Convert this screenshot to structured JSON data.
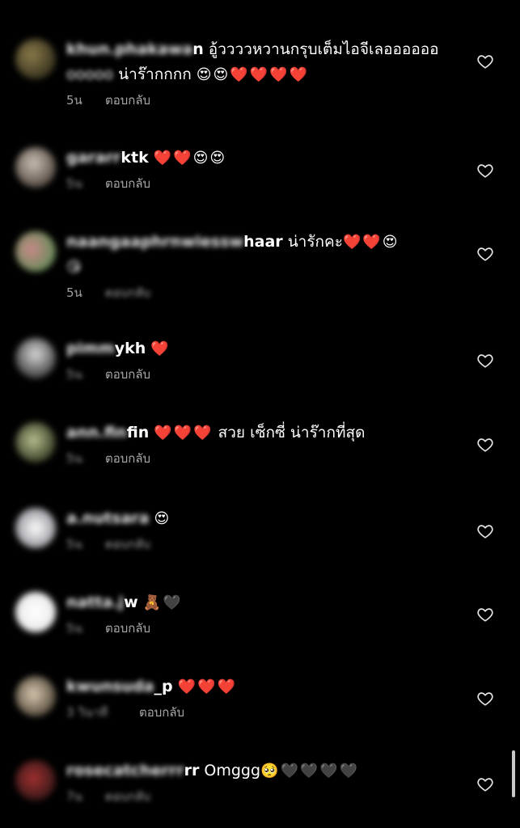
{
  "comments": [
    {
      "username_blurred": "khun.phakawa",
      "username_tail": "n",
      "text": "อู้ววววหวานกรุบเต็มไอจีเลออออออ",
      "text_line2_blurred": "ooooo",
      "text_line2": "น่าร๊ากกกก",
      "emoji": "😍😍❤️❤️❤️❤️",
      "time": "5น",
      "reply_label": "ตอบกลับ"
    },
    {
      "username_blurred": "gararr",
      "username_tail": "ktk",
      "text": "",
      "emoji": "❤️❤️😍😍",
      "time": "5น",
      "reply_label": "ตอบกลับ"
    },
    {
      "username_blurred": "naangaaphrnwiessw",
      "username_tail": "haar",
      "text": "น่ารักคะ",
      "emoji": "❤️❤️😍",
      "emoji_line2": "😘",
      "time": "5น",
      "reply_label": "ตอบกลับ"
    },
    {
      "username_blurred": "pimm",
      "username_tail": "ykh",
      "text": "",
      "emoji": "❤️",
      "time": "5น",
      "reply_label": "ตอบกลับ"
    },
    {
      "username_blurred": "ann.fin",
      "username_tail": "fin",
      "text": "สวย เซ็กซี่ น่าร๊ากที่สุด",
      "emoji": "❤️❤️❤️",
      "time": "5น",
      "reply_label": "ตอบกลับ"
    },
    {
      "username_blurred": "a.nutsara",
      "username_tail": "",
      "text": "",
      "emoji": "😍",
      "time": "5น",
      "reply_label": "ตอบกลับ"
    },
    {
      "username_blurred": "natta.j",
      "username_tail": "w",
      "text": "",
      "emoji": "🧸🖤",
      "time": "5น",
      "reply_label": "ตอบกลับ"
    },
    {
      "username_blurred": "kwunsuda",
      "username_tail": "_p",
      "text": "",
      "emoji": "❤️❤️❤️",
      "time": "3 วินาที",
      "reply_label": "ตอบกลับ"
    },
    {
      "username_blurred": "rosecatcherrr",
      "username_tail": "rr",
      "text": "Omggg",
      "emoji": "🥺🖤🖤🖤🖤",
      "time": "7น",
      "reply_label": "ตอบกลับ"
    }
  ],
  "icons": {
    "like": "heart-outline-icon"
  },
  "colors": {
    "background": "#000000",
    "meta_text": "#a0a0a0"
  }
}
